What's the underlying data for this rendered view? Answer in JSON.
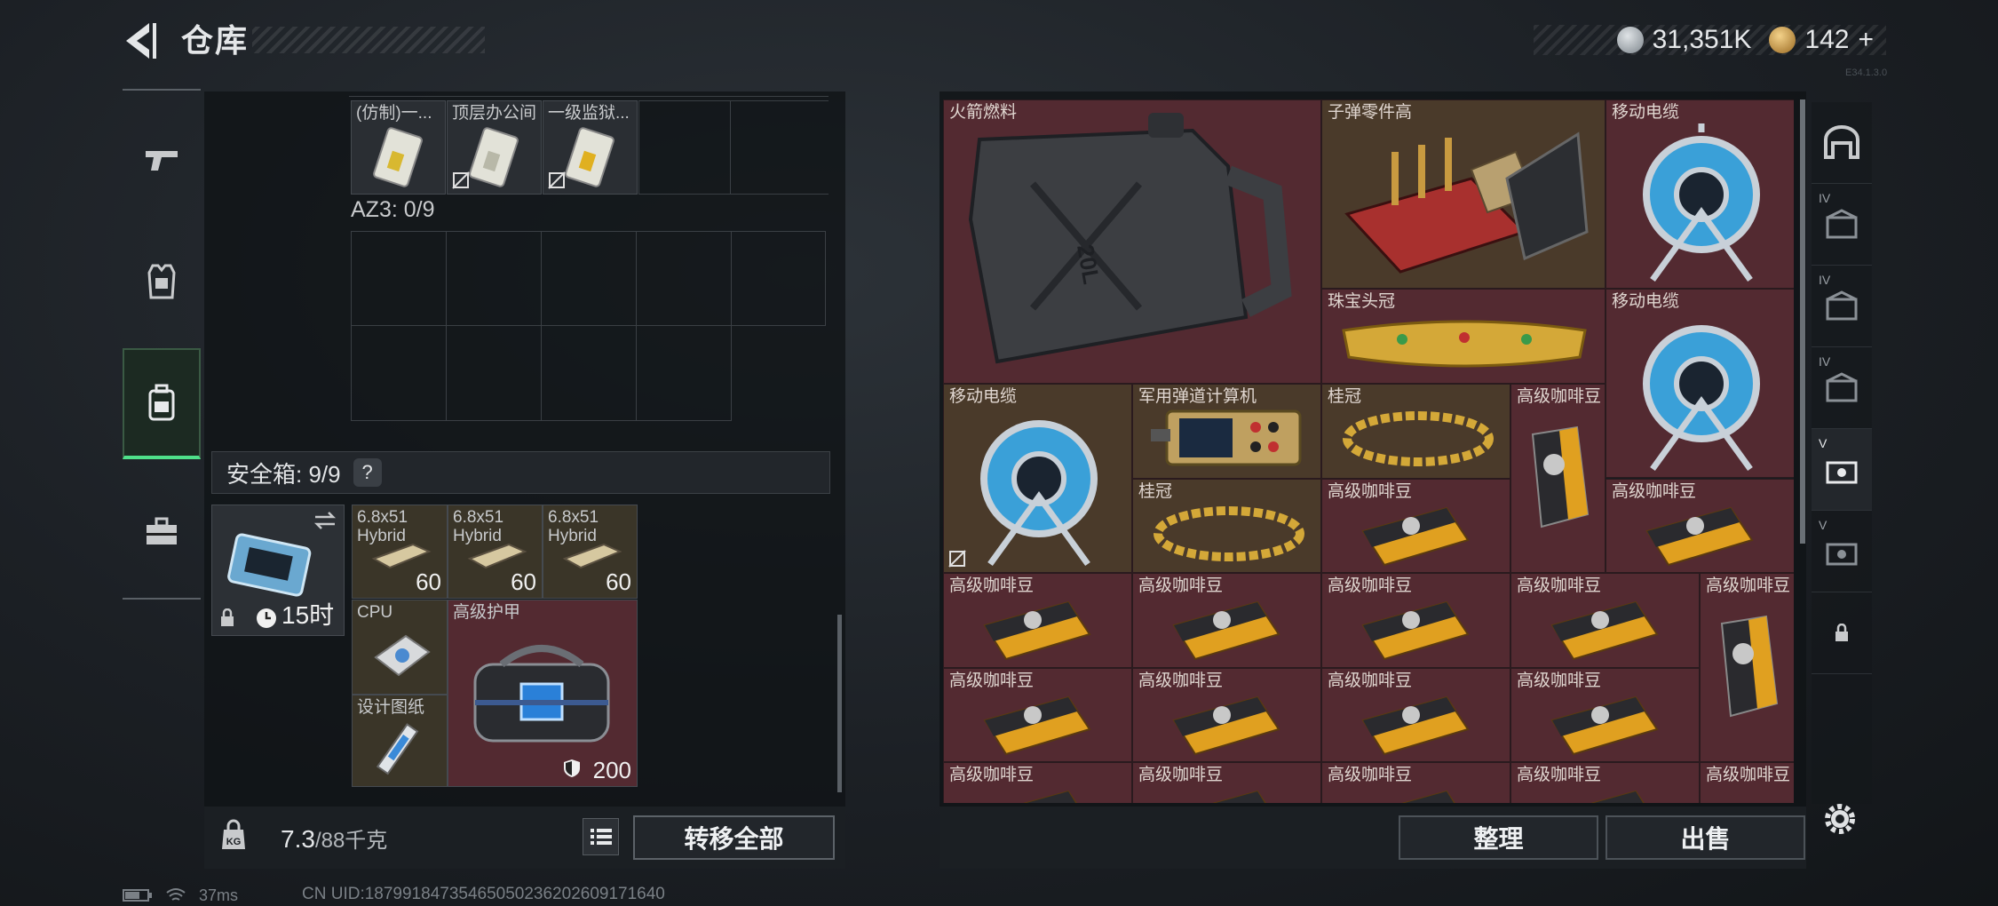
{
  "header": {
    "title": "仓库"
  },
  "currency": {
    "silver": "31,351K",
    "gold": "142",
    "gold_add": "+"
  },
  "version": "E34.1.3.0",
  "left_tabs": [
    "weapon-tab",
    "armor-tab",
    "backpack-tab",
    "case-tab"
  ],
  "container": {
    "items": [
      {
        "label": "(仿制)一..."
      },
      {
        "label": "顶层办公间"
      },
      {
        "label": "一级监狱..."
      }
    ],
    "az3_label": "AZ3: 0/9"
  },
  "safe_box": {
    "header": "安全箱: 9/9",
    "help": "?",
    "timer": "15时",
    "items": {
      "ammo1": {
        "label": "6.8x51 Hybrid",
        "count": "60"
      },
      "ammo2": {
        "label": "6.8x51 Hybrid",
        "count": "60"
      },
      "ammo3": {
        "label": "6.8x51 Hybrid",
        "count": "60"
      },
      "cpu": {
        "label": "CPU"
      },
      "armor": {
        "label": "高级护甲",
        "durability": "200"
      },
      "blueprint": {
        "label": "设计图纸"
      }
    }
  },
  "footer_left": {
    "weight": "7.3",
    "weight_unit": "/88千克",
    "transfer": "转移全部"
  },
  "stash": {
    "rocket_fuel": "火箭燃料",
    "bullet_parts": "子弹零件高",
    "cable": "移动电缆",
    "tiara": "珠宝头冠",
    "ballistic_computer": "军用弹道计算机",
    "laurel": "桂冠",
    "coffee": "高级咖啡豆"
  },
  "footer_right": {
    "tidy": "整理",
    "sell": "出售"
  },
  "status": {
    "ping": "37ms",
    "uid": "CN UID:187991847354650502362026091716​40"
  },
  "colors": {
    "item_red": "#532a31",
    "item_brown": "#4a3a2a",
    "accent_green": "#4fe08a"
  }
}
